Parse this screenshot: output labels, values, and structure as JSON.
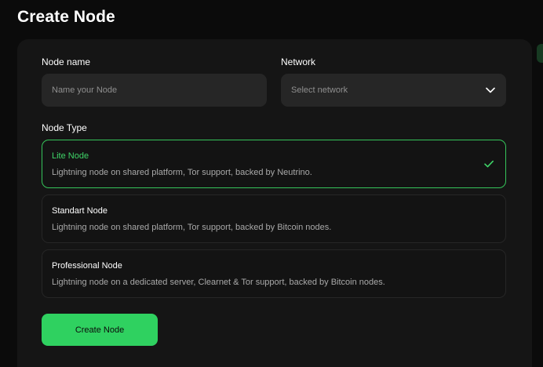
{
  "page": {
    "title": "Create Node"
  },
  "form": {
    "node_name": {
      "label": "Node name",
      "placeholder": "Name your Node",
      "value": ""
    },
    "network": {
      "label": "Network",
      "placeholder": "Select network"
    },
    "node_type_label": "Node Type",
    "node_types": [
      {
        "title": "Lite Node",
        "description": "Lightning node on shared platform, Tor support, backed by Neutrino.",
        "selected": true
      },
      {
        "title": "Standart Node",
        "description": "Lightning node on shared platform, Tor support, backed by Bitcoin nodes.",
        "selected": false
      },
      {
        "title": "Professional Node",
        "description": "Lightning node on a dedicated server, Clearnet & Tor support, backed by Bitcoin nodes.",
        "selected": false
      }
    ],
    "submit_label": "Create Node"
  },
  "colors": {
    "accent": "#2fd160",
    "background": "#0b0b0b",
    "card": "#151515",
    "input": "#262626"
  },
  "icons": {
    "select_chevron": "chevron-down-icon",
    "selected_check": "checkmark-icon"
  }
}
